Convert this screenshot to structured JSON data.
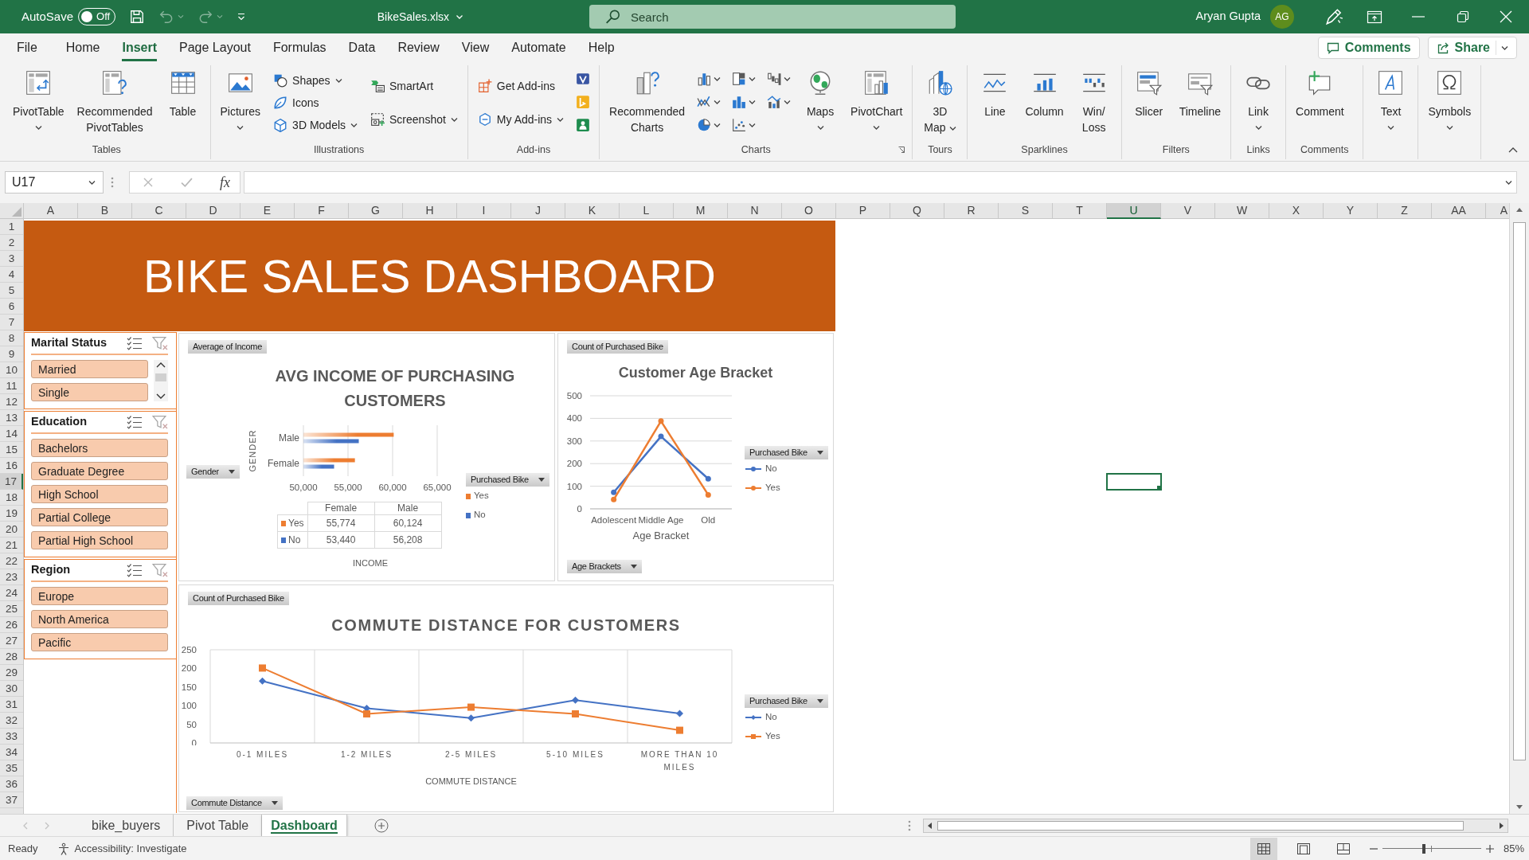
{
  "title_bar": {
    "autosave": {
      "label": "AutoSave",
      "state_label": "Off",
      "on": false
    },
    "quick_access": [
      {
        "disabled": false
      },
      {
        "disabled": true
      },
      {
        "disabled": true
      }
    ],
    "file_name": "BikeSales.xlsx",
    "search": {
      "placeholder": "Search"
    },
    "user": {
      "name": "Aryan Gupta",
      "initials": "AG"
    }
  },
  "ribbon_tabs": [
    {
      "label": "File",
      "selected": false
    },
    {
      "label": "Home",
      "selected": false
    },
    {
      "label": "Insert",
      "selected": true
    },
    {
      "label": "Page Layout",
      "selected": false
    },
    {
      "label": "Formulas",
      "selected": false
    },
    {
      "label": "Data",
      "selected": false
    },
    {
      "label": "Review",
      "selected": false
    },
    {
      "label": "View",
      "selected": false
    },
    {
      "label": "Automate",
      "selected": false
    },
    {
      "label": "Help",
      "selected": false
    }
  ],
  "ribbon_actions": [
    {
      "label": "Comments",
      "menu": false
    },
    {
      "label": "Share",
      "menu": true
    }
  ],
  "ribbon_groups": [
    {
      "label": "Tables",
      "columns": [
        [
          {
            "kind": "large",
            "lines": [
              "PivotTable"
            ],
            "menu": true
          }
        ],
        [
          {
            "kind": "large",
            "lines": [
              "Recommended",
              "PivotTables"
            ],
            "menu": false
          }
        ],
        [
          {
            "kind": "large",
            "lines": [
              "Table"
            ],
            "menu": false
          }
        ]
      ]
    },
    {
      "label": "Illustrations",
      "columns": [
        [
          {
            "kind": "large",
            "lines": [
              "Pictures"
            ],
            "menu": true
          }
        ],
        [
          {
            "kind": "small",
            "label": "Shapes",
            "menu": true
          },
          {
            "kind": "small",
            "label": "Icons",
            "menu": false
          },
          {
            "kind": "small",
            "label": "3D Models",
            "menu": true
          }
        ],
        [
          {
            "kind": "small",
            "label": "SmartArt",
            "menu": false
          },
          {
            "kind": "small",
            "label": "Screenshot",
            "menu": true
          }
        ]
      ]
    },
    {
      "label": "Add-ins",
      "columns": [
        [
          {
            "kind": "small",
            "label": "Get Add-ins",
            "menu": false
          },
          {
            "kind": "small",
            "label": "My Add-ins",
            "menu": true
          }
        ],
        [
          {
            "kind": "icon",
            "menu": false
          },
          {
            "kind": "icon",
            "menu": false
          },
          {
            "kind": "icon",
            "menu": false
          }
        ]
      ]
    },
    {
      "label": "Charts",
      "launcher": true,
      "columns": [
        [
          {
            "kind": "large",
            "lines": [
              "Recommended",
              "Charts"
            ],
            "menu": false
          }
        ],
        [
          {
            "kind": "icon",
            "menu": true
          },
          {
            "kind": "icon",
            "menu": true
          },
          {
            "kind": "icon",
            "menu": true
          }
        ],
        [
          {
            "kind": "icon",
            "menu": true
          },
          {
            "kind": "icon",
            "menu": true
          },
          {
            "kind": "icon",
            "menu": true
          }
        ],
        [
          {
            "kind": "icon",
            "menu": true
          },
          {
            "kind": "icon",
            "menu": true
          }
        ],
        [
          {
            "kind": "large",
            "lines": [
              "Maps"
            ],
            "menu": true
          }
        ],
        [
          {
            "kind": "large",
            "lines": [
              "PivotChart"
            ],
            "menu": true
          }
        ]
      ]
    },
    {
      "label": "Tours",
      "columns": [
        [
          {
            "kind": "large",
            "lines": [
              "3D",
              "Map"
            ],
            "menu": true
          }
        ]
      ]
    },
    {
      "label": "Sparklines",
      "columns": [
        [
          {
            "kind": "large",
            "lines": [
              "Line"
            ],
            "menu": false
          }
        ],
        [
          {
            "kind": "large",
            "lines": [
              "Column"
            ],
            "menu": false
          }
        ],
        [
          {
            "kind": "large",
            "lines": [
              "Win/",
              "Loss"
            ],
            "menu": false
          }
        ]
      ]
    },
    {
      "label": "Filters",
      "columns": [
        [
          {
            "kind": "large",
            "lines": [
              "Slicer"
            ],
            "menu": false
          }
        ],
        [
          {
            "kind": "large",
            "lines": [
              "Timeline"
            ],
            "menu": false
          }
        ]
      ]
    },
    {
      "label": "Links",
      "columns": [
        [
          {
            "kind": "large",
            "lines": [
              "Link"
            ],
            "menu": true
          }
        ]
      ]
    },
    {
      "label": "Comments",
      "columns": [
        [
          {
            "kind": "large",
            "lines": [
              "Comment"
            ],
            "menu": false
          }
        ]
      ]
    },
    {
      "columns": [
        [
          {
            "kind": "large",
            "lines": [
              "Text"
            ],
            "menu": true
          }
        ]
      ]
    },
    {
      "columns": [
        [
          {
            "kind": "large",
            "lines": [
              "Symbols"
            ],
            "menu": true
          }
        ]
      ]
    }
  ],
  "formula_bar": {
    "name_box": "U17",
    "cancel": {
      "disabled": true
    },
    "enter": {
      "disabled": true
    },
    "function_button": "fx"
  },
  "sheet": {
    "columns": [
      {
        "label": "A",
        "selected": false
      },
      {
        "label": "B",
        "selected": false
      },
      {
        "label": "C",
        "selected": false
      },
      {
        "label": "D",
        "selected": false
      },
      {
        "label": "E",
        "selected": false
      },
      {
        "label": "F",
        "selected": false
      },
      {
        "label": "G",
        "selected": false
      },
      {
        "label": "H",
        "selected": false
      },
      {
        "label": "I",
        "selected": false
      },
      {
        "label": "J",
        "selected": false
      },
      {
        "label": "K",
        "selected": false
      },
      {
        "label": "L",
        "selected": false
      },
      {
        "label": "M",
        "selected": false
      },
      {
        "label": "N",
        "selected": false
      },
      {
        "label": "O",
        "selected": false
      },
      {
        "label": "P",
        "selected": false
      },
      {
        "label": "Q",
        "selected": false
      },
      {
        "label": "R",
        "selected": false
      },
      {
        "label": "S",
        "selected": false
      },
      {
        "label": "T",
        "selected": false
      },
      {
        "label": "U",
        "selected": true
      },
      {
        "label": "V",
        "selected": false
      },
      {
        "label": "W",
        "selected": false
      },
      {
        "label": "X",
        "selected": false
      },
      {
        "label": "Y",
        "selected": false
      },
      {
        "label": "Z",
        "selected": false
      },
      {
        "label": "AA",
        "selected": false
      },
      {
        "label": "A",
        "selected": false
      }
    ],
    "rows": [
      {
        "label": "1",
        "selected": false
      },
      {
        "label": "2",
        "selected": false
      },
      {
        "label": "3",
        "selected": false
      },
      {
        "label": "4",
        "selected": false
      },
      {
        "label": "5",
        "selected": false
      },
      {
        "label": "6",
        "selected": false
      },
      {
        "label": "7",
        "selected": false
      },
      {
        "label": "8",
        "selected": false
      },
      {
        "label": "9",
        "selected": false
      },
      {
        "label": "10",
        "selected": false
      },
      {
        "label": "11",
        "selected": false
      },
      {
        "label": "12",
        "selected": false
      },
      {
        "label": "13",
        "selected": false
      },
      {
        "label": "14",
        "selected": false
      },
      {
        "label": "15",
        "selected": false
      },
      {
        "label": "16",
        "selected": false
      },
      {
        "label": "17",
        "selected": true
      },
      {
        "label": "18",
        "selected": false
      },
      {
        "label": "19",
        "selected": false
      },
      {
        "label": "20",
        "selected": false
      },
      {
        "label": "21",
        "selected": false
      },
      {
        "label": "22",
        "selected": false
      },
      {
        "label": "23",
        "selected": false
      },
      {
        "label": "24",
        "selected": false
      },
      {
        "label": "25",
        "selected": false
      },
      {
        "label": "26",
        "selected": false
      },
      {
        "label": "27",
        "selected": false
      },
      {
        "label": "28",
        "selected": false
      },
      {
        "label": "29",
        "selected": false
      },
      {
        "label": "30",
        "selected": false
      },
      {
        "label": "31",
        "selected": false
      },
      {
        "label": "32",
        "selected": false
      },
      {
        "label": "33",
        "selected": false
      },
      {
        "label": "34",
        "selected": false
      },
      {
        "label": "35",
        "selected": false
      },
      {
        "label": "36",
        "selected": false
      },
      {
        "label": "37",
        "selected": false
      }
    ]
  },
  "dashboard": {
    "title": "BIKE SALES DASHBOARD",
    "slicers": [
      {
        "title": "Marital Status",
        "scrollbar": true,
        "clear_filter": {
          "disabled": true
        },
        "items": [
          {
            "label": "Married",
            "selected": true
          },
          {
            "label": "Single",
            "selected": true
          }
        ]
      },
      {
        "title": "Education",
        "scrollbar": false,
        "clear_filter": {
          "disabled": true
        },
        "items": [
          {
            "label": "Bachelors",
            "selected": true
          },
          {
            "label": "Graduate Degree",
            "selected": true
          },
          {
            "label": "High School",
            "selected": true
          },
          {
            "label": "Partial College",
            "selected": true
          },
          {
            "label": "Partial High School",
            "selected": true
          }
        ]
      },
      {
        "title": "Region",
        "scrollbar": false,
        "clear_filter": {
          "disabled": true
        },
        "items": [
          {
            "label": "Europe",
            "selected": true
          },
          {
            "label": "North America",
            "selected": true
          },
          {
            "label": "Pacific",
            "selected": true
          }
        ]
      }
    ],
    "charts": [
      {
        "value_button": {
          "label": "Average of Income",
          "menu": false
        },
        "axis_button": {
          "label": "Gender",
          "menu": true
        },
        "legend_button": {
          "label": "Purchased Bike",
          "menu": true
        },
        "chart_data": {
          "type": "bar",
          "orientation": "horizontal",
          "title": "AVG INCOME OF PURCHASING CUSTOMERS",
          "xlabel": "INCOME",
          "ylabel": "GENDER",
          "categories": [
            "Male",
            "Female"
          ],
          "series": [
            {
              "name": "Yes",
              "color": "#ed7d31",
              "values": [
                60124,
                55774
              ]
            },
            {
              "name": "No",
              "color": "#4472c4",
              "values": [
                56208,
                53440
              ]
            }
          ],
          "xlim": [
            50000,
            65000
          ],
          "xticks": [
            {
              "value": 50000,
              "label": "50,000"
            },
            {
              "value": 55000,
              "label": "55,000"
            },
            {
              "value": 60000,
              "label": "60,000"
            },
            {
              "value": 65000,
              "label": "65,000"
            }
          ],
          "grid": true,
          "legend": "right"
        },
        "data_table": {
          "columns": [
            "Female",
            "Male"
          ],
          "rows": [
            {
              "label": "Yes",
              "color": "#ed7d31",
              "cells": [
                "55,774",
                "60,124"
              ]
            },
            {
              "label": "No",
              "color": "#4472c4",
              "cells": [
                "53,440",
                "56,208"
              ]
            }
          ]
        }
      },
      {
        "value_button": {
          "label": "Count of Purchased Bike",
          "menu": false
        },
        "axis_button": {
          "label": "Age Brackets",
          "menu": true
        },
        "legend_button": {
          "label": "Purchased Bike",
          "menu": true
        },
        "chart_data": {
          "type": "line",
          "title": "Customer Age Bracket",
          "xlabel": "Age Bracket",
          "categories": [
            "Adolescent",
            "Middle Age",
            "Old"
          ],
          "series": [
            {
              "name": "No",
              "color": "#4472c4",
              "marker": "circle",
              "values": [
                73,
                320,
                133
              ]
            },
            {
              "name": "Yes",
              "color": "#ed7d31",
              "marker": "circle",
              "values": [
                41,
                388,
                62
              ]
            }
          ],
          "ylim": [
            0,
            500
          ],
          "yticks": [
            0,
            100,
            200,
            300,
            400,
            500
          ],
          "grid": true,
          "legend": "right"
        }
      },
      {
        "value_button": {
          "label": "Count of Purchased Bike",
          "menu": false
        },
        "axis_button": {
          "label": "Commute Distance",
          "menu": true
        },
        "legend_button": {
          "label": "Purchased Bike",
          "menu": true
        },
        "chart_data": {
          "type": "line",
          "title": "COMMUTE DISTANCE FOR CUSTOMERS",
          "xlabel": "COMMUTE DISTANCE",
          "categories": [
            "0-1 MILES",
            "1-2 MILES",
            "2-5 MILES",
            "5-10 MILES",
            "MORE THAN 10 MILES"
          ],
          "series": [
            {
              "name": "No",
              "color": "#4472c4",
              "marker": "diamond",
              "values": [
                166,
                93,
                67,
                115,
                79
              ]
            },
            {
              "name": "Yes",
              "color": "#ed7d31",
              "marker": "square",
              "values": [
                201,
                78,
                96,
                78,
                34
              ]
            }
          ],
          "ylim": [
            0,
            250
          ],
          "yticks": [
            0,
            50,
            100,
            150,
            200,
            250
          ],
          "grid": true,
          "legend": "right"
        }
      }
    ]
  },
  "sheet_nav": [
    {
      "disabled": true
    },
    {
      "disabled": true
    }
  ],
  "sheet_tabs": [
    {
      "label": "bike_buyers",
      "selected": false
    },
    {
      "label": "Pivot Table",
      "selected": false
    },
    {
      "label": "Dashboard",
      "selected": true
    }
  ],
  "status_bar": {
    "mode": "Ready",
    "accessibility": "Accessibility: Investigate",
    "views": [
      {
        "selected": true
      },
      {
        "selected": false
      },
      {
        "selected": false
      }
    ],
    "zoom": {
      "level": 0.42,
      "reading": "85%"
    }
  }
}
